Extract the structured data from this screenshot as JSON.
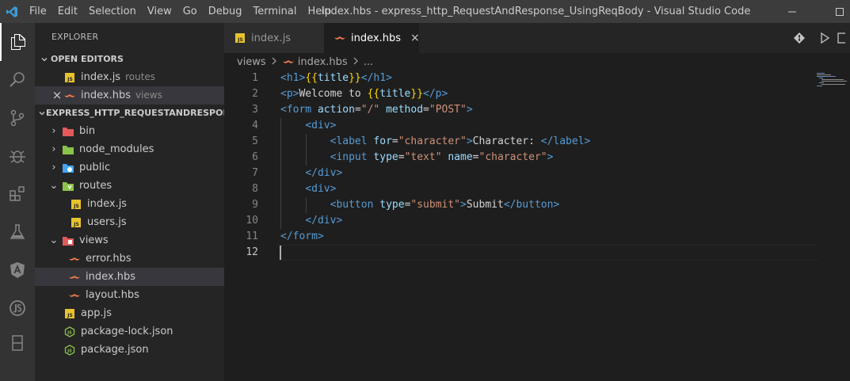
{
  "window": {
    "title": "index.hbs - express_http_RequestAndResponse_UsingReqBody - Visual Studio Code"
  },
  "menu": [
    "File",
    "Edit",
    "Selection",
    "View",
    "Go",
    "Debug",
    "Terminal",
    "Help"
  ],
  "activity_bar": [
    "files-icon",
    "search-icon",
    "source-control-icon",
    "debug-icon",
    "extensions-icon",
    "test-flask-icon",
    "angular-icon",
    "node-icon",
    "remote-icon"
  ],
  "sidebar": {
    "title": "EXPLORER",
    "open_editors": {
      "header": "OPEN EDITORS",
      "items": [
        {
          "name": "index.js",
          "desc": "routes",
          "icon": "js-icon"
        },
        {
          "name": "index.hbs",
          "desc": "views",
          "icon": "hbs-icon",
          "close": "×"
        }
      ]
    },
    "project": {
      "header": "EXPRESS_HTTP_REQUESTANDRESPON...",
      "tree": [
        {
          "name": "bin",
          "type": "folder",
          "state": "›"
        },
        {
          "name": "node_modules",
          "type": "folder",
          "state": "›"
        },
        {
          "name": "public",
          "type": "folder",
          "state": "›"
        },
        {
          "name": "routes",
          "type": "folder",
          "state": "⌄"
        },
        {
          "name": "index.js",
          "type": "js"
        },
        {
          "name": "users.js",
          "type": "js"
        },
        {
          "name": "views",
          "type": "folder",
          "state": "⌄"
        },
        {
          "name": "error.hbs",
          "type": "hbs"
        },
        {
          "name": "index.hbs",
          "type": "hbs"
        },
        {
          "name": "layout.hbs",
          "type": "hbs"
        },
        {
          "name": "app.js",
          "type": "js"
        },
        {
          "name": "package-lock.json",
          "type": "json"
        },
        {
          "name": "package.json",
          "type": "json"
        }
      ]
    }
  },
  "tabs": [
    {
      "label": "index.js",
      "active": false
    },
    {
      "label": "index.hbs",
      "active": true,
      "close": "×"
    }
  ],
  "breadcrumb": [
    "views",
    "index.hbs",
    "..."
  ],
  "editor": {
    "current_line": 12,
    "line_numbers": [
      "1",
      "2",
      "3",
      "4",
      "5",
      "6",
      "7",
      "8",
      "9",
      "10",
      "11",
      "12"
    ]
  },
  "colors": {
    "tag": "#569cd6",
    "attribute": "#9cdcfe",
    "string": "#ce9178",
    "text": "#d4d4d4",
    "mustache_outer": "#ffd700",
    "mustache_inner": "#da70d6",
    "js_icon": "#e8c32c",
    "hbs_icon": "#f0794a"
  }
}
